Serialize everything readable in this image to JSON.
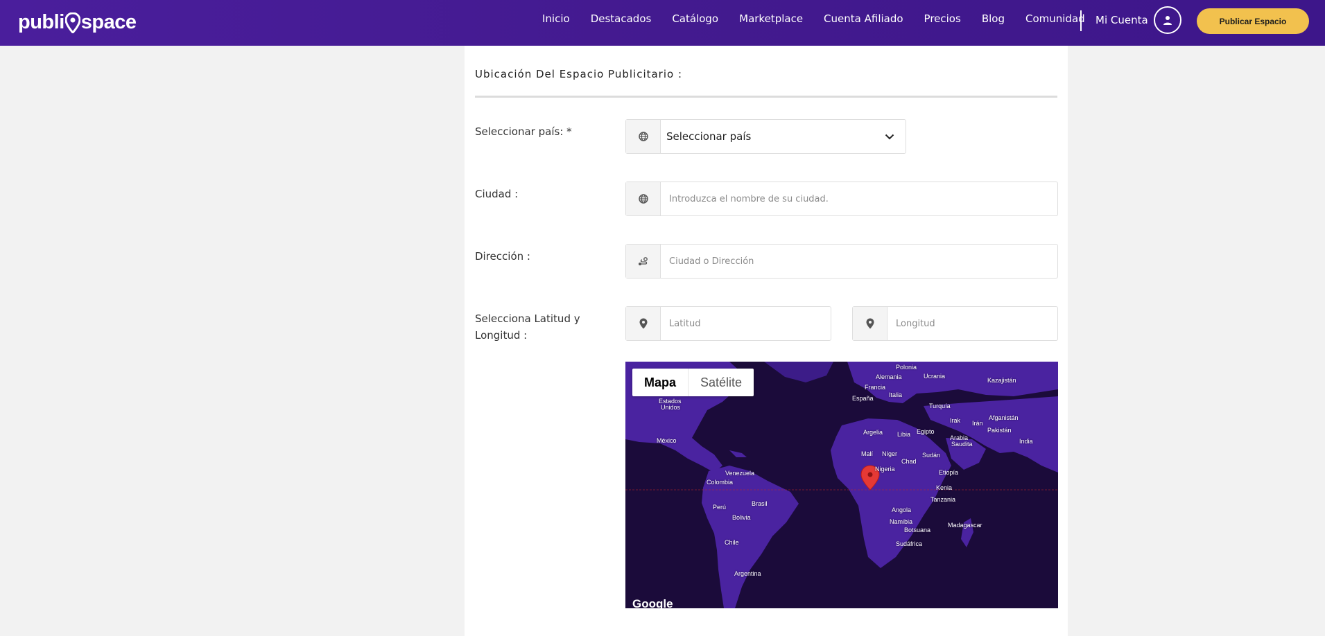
{
  "brand": {
    "logo_left": "publi",
    "logo_right": "space"
  },
  "nav": {
    "links": [
      "Inicio",
      "Destacados",
      "Catálogo",
      "Marketplace",
      "Cuenta Afiliado",
      "Precios",
      "Blog",
      "Comunidad"
    ],
    "account_label": "Mi Cuenta",
    "publish_label": "Publicar Espacio"
  },
  "form": {
    "section_title": "Ubicación Del Espacio Publicitario :",
    "country": {
      "label": "Seleccionar país: *",
      "value": "Seleccionar país"
    },
    "city": {
      "label": "Ciudad :",
      "placeholder": "Introduzca el nombre de su ciudad."
    },
    "address": {
      "label": "Dirección :",
      "placeholder": "Ciudad o Dirección"
    },
    "latlng": {
      "label_line1": "Selecciona Latitud y",
      "label_line2": "Longitud :",
      "lat_placeholder": "Latitud",
      "lng_placeholder": "Longitud"
    }
  },
  "map": {
    "tab_map": "Mapa",
    "tab_satellite": "Satélite",
    "attribution": "Google",
    "labels": [
      "Polonia",
      "Ucrania",
      "Alemania",
      "Francia",
      "Kazajistán",
      "Italia",
      "España",
      "Estados",
      "Unidos",
      "Turquía",
      "Afganistán",
      "Irak",
      "Irán",
      "Pakistán",
      "Argelia",
      "Libia",
      "Egipto",
      "Arabia",
      "Saudita",
      "India",
      "México",
      "Malí",
      "Níger",
      "Chad",
      "Sudán",
      "Nigeria",
      "Venezuela",
      "Etiopía",
      "Colombia",
      "Kenia",
      "Tanzania",
      "Brasil",
      "Perú",
      "Angola",
      "Bolivia",
      "Namibia",
      "Botsuana",
      "Madagascar",
      "Chile",
      "Sudáfrica",
      "Argentina"
    ],
    "colors": {
      "ocean": "#1b0b3a",
      "land": "#4a23a0",
      "marker": "#e53935"
    }
  },
  "colors": {
    "nav_bg": "#4a1e9c",
    "accent": "#f2c14e"
  }
}
